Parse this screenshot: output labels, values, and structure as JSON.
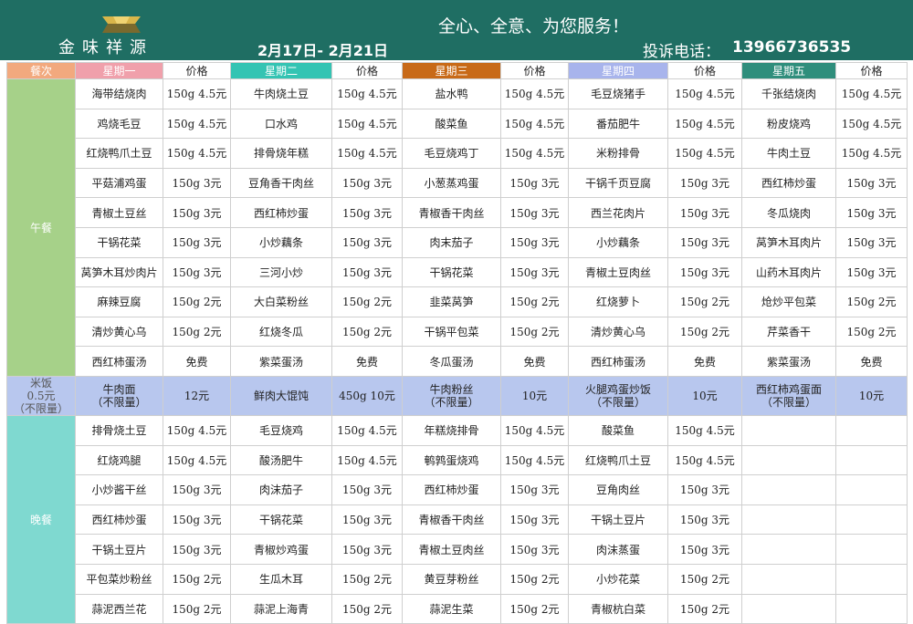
{
  "header": {
    "logo_text": "金味祥源",
    "slogan": "全心、全意、为您服务！",
    "dates": "2月17日- 2月21日",
    "phone_label": "投诉电话：",
    "phone_number": "13966736535"
  },
  "table": {
    "meal_header": "餐次",
    "price_header": "价格",
    "days": [
      "星期一",
      "星期二",
      "星期三",
      "星期四",
      "星期五"
    ],
    "sections": {
      "lunch": "午餐",
      "rice": "米饭\n0.5元\n（不限量）",
      "dinner": "晚餐"
    },
    "lunch_rows": [
      [
        "海带结烧肉",
        "150g 4.5元",
        "牛肉烧土豆",
        "150g 4.5元",
        "盐水鸭",
        "150g 4.5元",
        "毛豆烧猪手",
        "150g 4.5元",
        "千张结烧肉",
        "150g 4.5元"
      ],
      [
        "鸡烧毛豆",
        "150g 4.5元",
        "口水鸡",
        "150g 4.5元",
        "酸菜鱼",
        "150g 4.5元",
        "番茄肥牛",
        "150g 4.5元",
        "粉皮烧鸡",
        "150g 4.5元"
      ],
      [
        "红烧鸭爪土豆",
        "150g 4.5元",
        "排骨烧年糕",
        "150g 4.5元",
        "毛豆烧鸡丁",
        "150g 4.5元",
        "米粉排骨",
        "150g 4.5元",
        "牛肉土豆",
        "150g 4.5元"
      ],
      [
        "平菇浦鸡蛋",
        "150g 3元",
        "豆角香干肉丝",
        "150g 3元",
        "小葱蒸鸡蛋",
        "150g 3元",
        "干锅千页豆腐",
        "150g 3元",
        "西红柿炒蛋",
        "150g 3元"
      ],
      [
        "青椒土豆丝",
        "150g 3元",
        "西红柿炒蛋",
        "150g 3元",
        "青椒香干肉丝",
        "150g 3元",
        "西兰花肉片",
        "150g 3元",
        "冬瓜烧肉",
        "150g 3元"
      ],
      [
        "干锅花菜",
        "150g 3元",
        "小炒藕条",
        "150g 3元",
        "肉末茄子",
        "150g 3元",
        "小炒藕条",
        "150g 3元",
        "莴笋木耳肉片",
        "150g 3元"
      ],
      [
        "莴笋木耳炒肉片",
        "150g 3元",
        "三河小炒",
        "150g 3元",
        "干锅花菜",
        "150g 3元",
        "青椒土豆肉丝",
        "150g 3元",
        "山药木耳肉片",
        "150g 3元"
      ],
      [
        "麻辣豆腐",
        "150g 2元",
        "大白菜粉丝",
        "150g 2元",
        "韭菜莴笋",
        "150g 2元",
        "红烧萝卜",
        "150g 2元",
        "炝炒平包菜",
        "150g 2元"
      ],
      [
        "清炒黄心乌",
        "150g 2元",
        "红烧冬瓜",
        "150g 2元",
        "干锅平包菜",
        "150g 2元",
        "清炒黄心乌",
        "150g 2元",
        "芹菜香干",
        "150g 2元"
      ],
      [
        "西红柿蛋汤",
        "免费",
        "紫菜蛋汤",
        "免费",
        "冬瓜蛋汤",
        "免费",
        "西红柿蛋汤",
        "免费",
        "紫菜蛋汤",
        "免费"
      ]
    ],
    "rice_row": [
      "牛肉面\n（不限量）",
      "12元",
      "鲜肉大馄饨",
      "450g 10元",
      "牛肉粉丝\n（不限量）",
      "10元",
      "火腿鸡蛋炒饭\n（不限量）",
      "10元",
      "西红柿鸡蛋面\n（不限量）",
      "10元"
    ],
    "dinner_rows": [
      [
        "排骨烧土豆",
        "150g 4.5元",
        "毛豆烧鸡",
        "150g 4.5元",
        "年糕烧排骨",
        "150g 4.5元",
        "酸菜鱼",
        "150g 4.5元",
        "",
        ""
      ],
      [
        "红烧鸡腿",
        "150g 4.5元",
        "酸汤肥牛",
        "150g 4.5元",
        "鹌鹑蛋烧鸡",
        "150g 4.5元",
        "红烧鸭爪土豆",
        "150g 4.5元",
        "",
        ""
      ],
      [
        "小炒酱干丝",
        "150g 3元",
        "肉沫茄子",
        "150g 3元",
        "西红柿炒蛋",
        "150g 3元",
        "豆角肉丝",
        "150g 3元",
        "",
        ""
      ],
      [
        "西红柿炒蛋",
        "150g 3元",
        "干锅花菜",
        "150g 3元",
        "青椒香干肉丝",
        "150g 3元",
        "干锅土豆片",
        "150g 3元",
        "",
        ""
      ],
      [
        "干锅土豆片",
        "150g 3元",
        "青椒炒鸡蛋",
        "150g 3元",
        "青椒土豆肉丝",
        "150g 3元",
        "肉沫蒸蛋",
        "150g 3元",
        "",
        ""
      ],
      [
        "平包菜炒粉丝",
        "150g 2元",
        "生瓜木耳",
        "150g 2元",
        "黄豆芽粉丝",
        "150g 2元",
        "小炒花菜",
        "150g 2元",
        "",
        ""
      ],
      [
        "蒜泥西兰花",
        "150g 2元",
        "蒜泥上海青",
        "150g 2元",
        "蒜泥生菜",
        "150g 2元",
        "青椒杭白菜",
        "150g 2元",
        "",
        ""
      ]
    ]
  },
  "colors": {
    "header_bg": "#1f6e63",
    "monday": "#f0a0ab",
    "tuesday": "#34c4b3",
    "wednesday": "#c86a18",
    "thursday": "#a8b4ec",
    "friday": "#2f8e7c",
    "lunch": "#a6d189",
    "rice": "#b8c7ee",
    "dinner": "#7fd9d0"
  }
}
